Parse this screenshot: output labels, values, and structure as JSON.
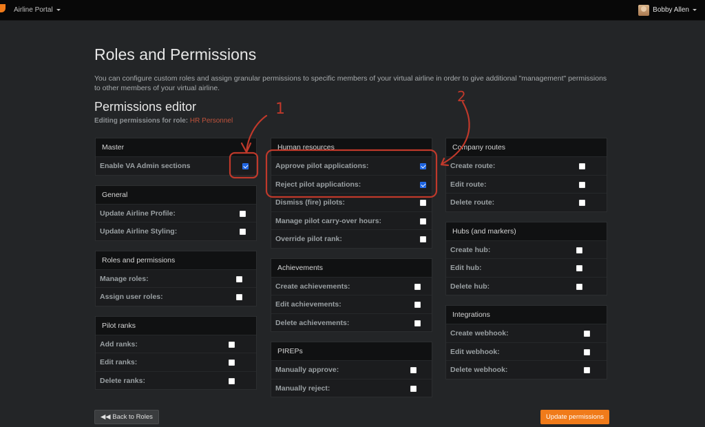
{
  "nav": {
    "brand": "Airline Portal",
    "user": "Bobby Allen"
  },
  "page": {
    "title": "Roles and Permissions",
    "description": "You can configure custom roles and assign granular permissions to specific members of your virtual airline in order to give additional \"management\" permissions to other members of your virtual airline.",
    "editor_title": "Permissions editor",
    "editing_prefix": "Editing permissions for role:",
    "role_name": "HR Personnel"
  },
  "columns": [
    [
      {
        "title": "Master",
        "items": [
          {
            "label": "Enable VA Admin sections",
            "checked": true
          }
        ]
      },
      {
        "title": "General",
        "items": [
          {
            "label": "Update Airline Profile:",
            "checked": false
          },
          {
            "label": "Update Airline Styling:",
            "checked": false
          }
        ]
      },
      {
        "title": "Roles and permissions",
        "items": [
          {
            "label": "Manage roles:",
            "checked": false
          },
          {
            "label": "Assign user roles:",
            "checked": false
          }
        ]
      },
      {
        "title": "Pilot ranks",
        "items": [
          {
            "label": "Add ranks:",
            "checked": false
          },
          {
            "label": "Edit ranks:",
            "checked": false
          },
          {
            "label": "Delete ranks:",
            "checked": false
          }
        ]
      }
    ],
    [
      {
        "title": "Human resources",
        "items": [
          {
            "label": "Approve pilot applications:",
            "checked": true
          },
          {
            "label": "Reject pilot applications:",
            "checked": true
          },
          {
            "label": "Dismiss (fire) pilots:",
            "checked": false
          },
          {
            "label": "Manage pilot carry-over hours:",
            "checked": false
          },
          {
            "label": "Override pilot rank:",
            "checked": false
          }
        ]
      },
      {
        "title": "Achievements",
        "items": [
          {
            "label": "Create achievements:",
            "checked": false
          },
          {
            "label": "Edit achievements:",
            "checked": false
          },
          {
            "label": "Delete achievements:",
            "checked": false
          }
        ]
      },
      {
        "title": "PIREPs",
        "items": [
          {
            "label": "Manually approve:",
            "checked": false
          },
          {
            "label": "Manually reject:",
            "checked": false
          }
        ]
      }
    ],
    [
      {
        "title": "Company routes",
        "items": [
          {
            "label": "Create route:",
            "checked": false
          },
          {
            "label": "Edit route:",
            "checked": false
          },
          {
            "label": "Delete route:",
            "checked": false
          }
        ]
      },
      {
        "title": "Hubs (and markers)",
        "items": [
          {
            "label": "Create hub:",
            "checked": false
          },
          {
            "label": "Edit hub:",
            "checked": false
          },
          {
            "label": "Delete hub:",
            "checked": false
          }
        ]
      },
      {
        "title": "Integrations",
        "items": [
          {
            "label": "Create webhook:",
            "checked": false
          },
          {
            "label": "Edit webhook:",
            "checked": false
          },
          {
            "label": "Delete webhook:",
            "checked": false
          }
        ]
      }
    ]
  ],
  "buttons": {
    "back": "◀◀ Back to Roles",
    "update": "Update permissions"
  },
  "annotations": {
    "marker1": "1",
    "marker2": "2",
    "color": "#c0392b"
  }
}
